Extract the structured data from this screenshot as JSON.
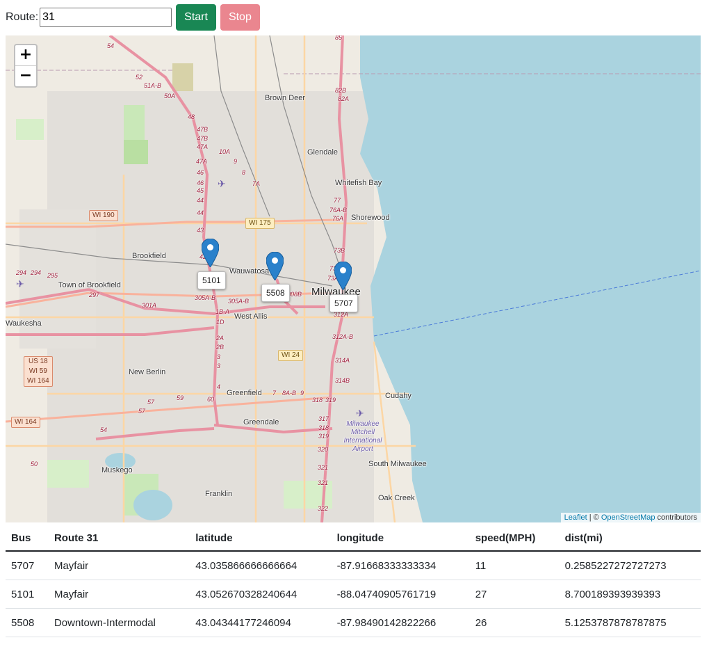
{
  "toolbar": {
    "route_label": "Route:",
    "route_value": "31",
    "start_label": "Start",
    "stop_label": "Stop",
    "start_color": "#198754",
    "stop_color": "#ea868f"
  },
  "map": {
    "zoom_in": "+",
    "zoom_out": "−",
    "attribution_leaflet": "Leaflet",
    "attribution_sep": " | © ",
    "attribution_osm": "OpenStreetMap",
    "attribution_rest": " contributors",
    "places": {
      "brown_deer": "Brown Deer",
      "glendale": "Glendale",
      "whitefish_bay": "Whitefish Bay",
      "shorewood": "Shorewood",
      "brookfield": "Brookfield",
      "wauwatosa": "Wauwatosa",
      "milwaukee": "Milwaukee",
      "town_of_brookfield": "Town of Brookfield",
      "waukesha": "Waukesha",
      "west_allis": "West Allis",
      "new_berlin": "New Berlin",
      "greenfield": "Greenfield",
      "greendale": "Greendale",
      "cudahy": "Cudahy",
      "south_milwaukee": "South Milwaukee",
      "muskego": "Muskego",
      "franklin": "Franklin",
      "oak_creek": "Oak Creek",
      "airport": "Milwaukee Mitchell International Airport"
    },
    "shields": {
      "wi190": "WI 190",
      "wi175": "WI 175",
      "wi24": "WI 24",
      "wi164": "WI 164",
      "us18": "US 18",
      "wi59": "WI 59",
      "wi164b": "WI 164"
    },
    "exits": [
      "85",
      "82B",
      "82A",
      "54",
      "52",
      "51A-B",
      "50A",
      "48",
      "47B",
      "47B",
      "47A",
      "10A",
      "9",
      "47A",
      "46",
      "46",
      "45",
      "8",
      "7A",
      "77",
      "76A-B",
      "76A",
      "44",
      "44",
      "43",
      "73B",
      "42",
      "73C",
      "73A",
      "305A-B",
      "305A-B",
      "308B",
      "312A",
      "1B-A",
      "1D",
      "312A-B",
      "2A",
      "2B",
      "3",
      "3",
      "314A",
      "4",
      "314B",
      "7",
      "8A-B",
      "9",
      "318",
      "319",
      "317",
      "318",
      "319",
      "320",
      "321",
      "321",
      "322",
      "294",
      "294",
      "295",
      "297",
      "301A",
      "59",
      "60",
      "57",
      "57",
      "54",
      "50"
    ],
    "markers": [
      {
        "bus": "5101"
      },
      {
        "bus": "5508"
      },
      {
        "bus": "5707"
      }
    ],
    "colors": {
      "water": "#aad3df",
      "land": "#f1ede6",
      "motorway": "#e892a2",
      "trunk": "#f9b29c",
      "primary": "#fcd6a4",
      "marker": "#2a81cb"
    }
  },
  "table": {
    "headers": [
      "Bus",
      "Route 31",
      "latitude",
      "longitude",
      "speed(MPH)",
      "dist(mi)"
    ],
    "rows": [
      [
        "5707",
        "Mayfair",
        "43.035866666666664",
        "-87.91668333333334",
        "11",
        "0.2585227272727273"
      ],
      [
        "5101",
        "Mayfair",
        "43.052670328240644",
        "-88.04740905761719",
        "27",
        "8.700189393939393"
      ],
      [
        "5508",
        "Downtown-Intermodal",
        "43.04344177246094",
        "-87.98490142822266",
        "26",
        "5.1253787878787875"
      ]
    ]
  }
}
